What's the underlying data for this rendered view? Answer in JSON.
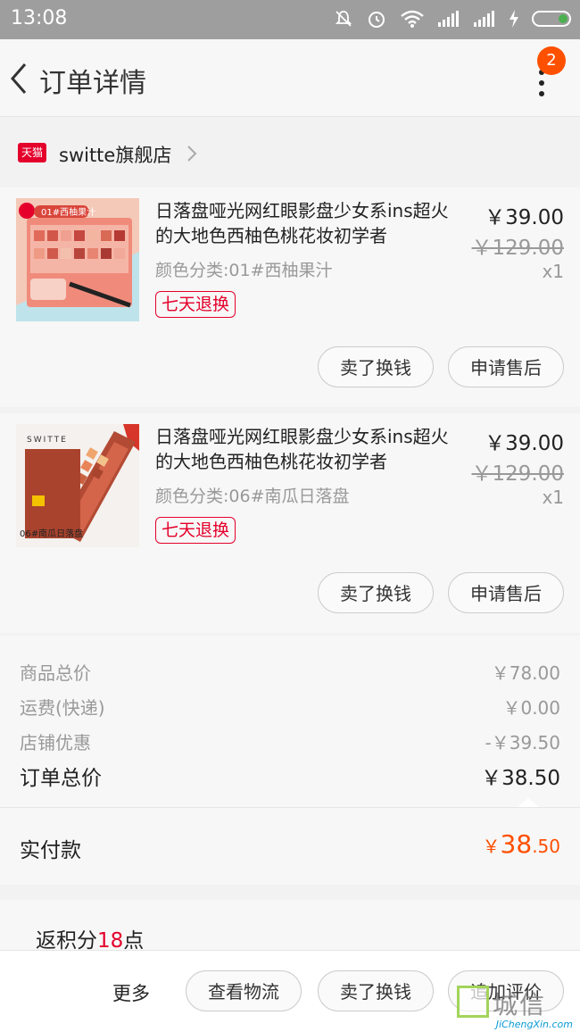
{
  "status_bar": {
    "time": "13:08"
  },
  "nav": {
    "title": "订单详情",
    "badge_count": "2"
  },
  "store": {
    "brand_tag": "天猫",
    "name": "switte旗舰店"
  },
  "items": [
    {
      "title": "日落盘哑光网红眼影盘少女系ins超火的大地色西柚色桃花妆初学者",
      "spec": "颜色分类:01#西柚果汁",
      "tag": "七天退换",
      "price": "￥39.00",
      "original_price": "￥129.00",
      "qty": "x1",
      "thumb_caption": "01#西柚果汁",
      "btn_sell": "卖了换钱",
      "btn_after": "申请售后"
    },
    {
      "title": "日落盘哑光网红眼影盘少女系ins超火的大地色西柚色桃花妆初学者",
      "spec": "颜色分类:06#南瓜日落盘",
      "tag": "七天退换",
      "price": "￥39.00",
      "original_price": "￥129.00",
      "qty": "x1",
      "thumb_caption": "06#南瓜日落盘",
      "thumb_brand": "SWITTE",
      "btn_sell": "卖了换钱",
      "btn_after": "申请售后"
    }
  ],
  "summary": {
    "goods_label": "商品总价",
    "goods_value": "￥78.00",
    "shipping_label": "运费(快递)",
    "shipping_value": "￥0.00",
    "discount_label": "店铺优惠",
    "discount_value": "-￥39.50",
    "total_label": "订单总价",
    "total_value": "￥38.50"
  },
  "paid": {
    "label": "实付款",
    "currency": "￥",
    "int": "38",
    "dec": ".50"
  },
  "points": {
    "prefix": "返积分",
    "value": "18",
    "suffix": "点"
  },
  "bottom_bar": {
    "more": "更多",
    "btn_logistics": "查看物流",
    "btn_sell": "卖了换钱",
    "btn_review": "追加评价"
  },
  "watermark": {
    "text": "城信",
    "sub": "JiChengXin.com"
  },
  "colors": {
    "accent": "#ff5000",
    "tmall_red": "#e4002b",
    "status_bar": "#9e9e9e"
  }
}
